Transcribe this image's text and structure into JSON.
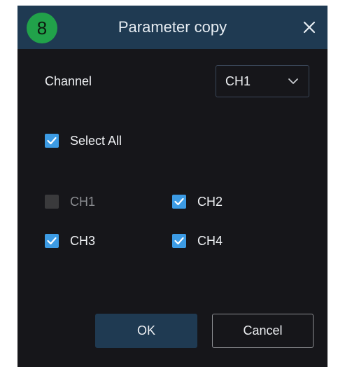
{
  "dialog": {
    "badge": "8",
    "title": "Parameter copy",
    "close_icon": "close-icon"
  },
  "channel": {
    "label": "Channel",
    "selected": "CH1",
    "dropdown_icon": "chevron-down-icon"
  },
  "select_all": {
    "label": "Select All",
    "checked": true
  },
  "channels": [
    {
      "label": "CH1",
      "checked": false,
      "enabled": false
    },
    {
      "label": "CH2",
      "checked": true,
      "enabled": true
    },
    {
      "label": "CH3",
      "checked": true,
      "enabled": true
    },
    {
      "label": "CH4",
      "checked": true,
      "enabled": true
    }
  ],
  "buttons": {
    "ok": "OK",
    "cancel": "Cancel"
  },
  "colors": {
    "titlebar": "#1f3a52",
    "background": "#16161a",
    "checkbox_checked": "#3c9be4",
    "badge": "#21a24a"
  }
}
